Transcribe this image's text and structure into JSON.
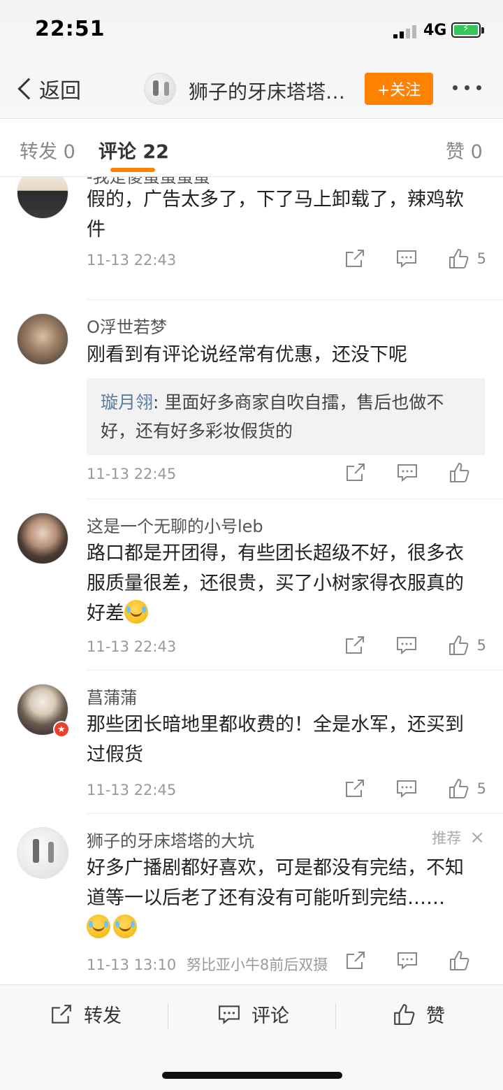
{
  "status_bar": {
    "time": "22:51",
    "network": "4G"
  },
  "header": {
    "back_label": "返回",
    "title": "狮子的牙床塔塔…",
    "follow_label": "+关注"
  },
  "tabs": [
    {
      "label": "转发 0",
      "active": false
    },
    {
      "label": "评论 22",
      "active": true
    },
    {
      "label": "赞 0",
      "active": false
    }
  ],
  "comments": [
    {
      "user": "-我是傻蛋蛋蛋蛋",
      "text": "假的，广告太多了，下了马上卸载了，辣鸡软件",
      "time": "11-13 22:43",
      "likes": "5"
    },
    {
      "user": "O浮世若梦",
      "text": "刚看到有评论说经常有优惠，还没下呢",
      "reply": {
        "name": "璇月翎",
        "text": ": 里面好多商家自吹自擂，售后也做不好，还有好多彩妆假货的"
      },
      "time": "11-13 22:45",
      "likes": ""
    },
    {
      "user": "这是一个无聊的小号leb",
      "text": "路口都是开团得，有些团长超级不好，很多衣服质量很差，还很贵，买了小树家得衣服真的好差",
      "time": "11-13 22:43",
      "likes": "5"
    },
    {
      "user": "菖蒲蒲",
      "text": "那些团长暗地里都收费的！全是水军，还买到过假货",
      "time": "11-13 22:45",
      "likes": "5"
    },
    {
      "user": "狮子的牙床塔塔的大坑",
      "recommend": "推荐",
      "text": "好多广播剧都好喜欢，可是都没有完结，不知道等一以后老了还有没有可能听到完结……",
      "time": "11-13 13:10",
      "device": "努比亚小牛8前后双摄",
      "likes": ""
    }
  ],
  "bottom_bar": {
    "repost": "转发",
    "comment": "评论",
    "like": "赞"
  },
  "colors": {
    "accent": "#ff8200",
    "reply_name": "#5b7ba0"
  }
}
